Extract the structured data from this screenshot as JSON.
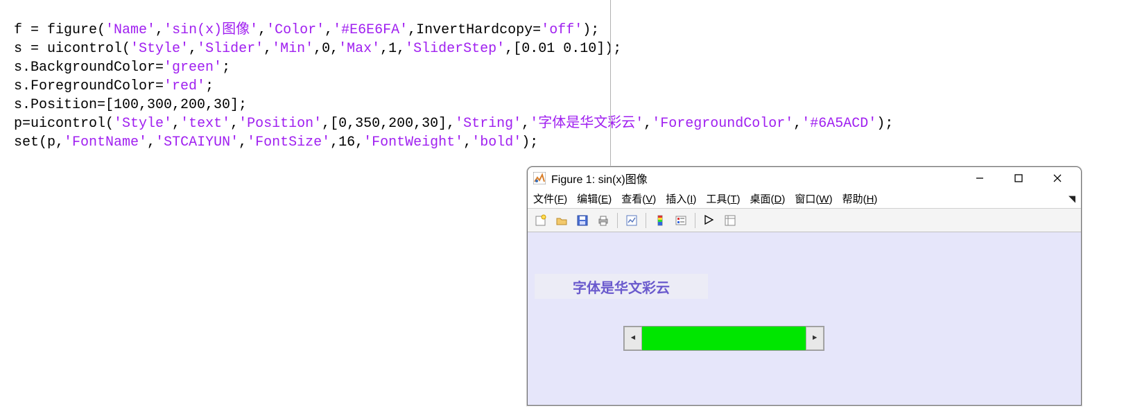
{
  "code": {
    "line1_pre": "f = figure(",
    "line1_s1": "'Name'",
    "line1_s2": "'sin(x)图像'",
    "line1_s3": "'Color'",
    "line1_s4": "'#E6E6FA'",
    "line1_tail": ",InvertHardcopy=",
    "line1_s5": "'off'",
    "line1_end": ");",
    "line2_pre": "s = uicontrol(",
    "line2_s1": "'Style'",
    "line2_s2": "'Slider'",
    "line2_s3": "'Min'",
    "line2_n1": ",0,",
    "line2_s4": "'Max'",
    "line2_n2": ",1,",
    "line2_s5": "'SliderStep'",
    "line2_n3": ",[0.01 0.10]);",
    "line3_pre": "s.BackgroundColor=",
    "line3_s1": "'green'",
    "line3_end": ";",
    "line4_pre": "s.ForegroundColor=",
    "line4_s1": "'red'",
    "line4_end": ";",
    "line5": "s.Position=[100,300,200,30];",
    "line6_pre": "p=uicontrol(",
    "line6_s1": "'Style'",
    "line6_s2": "'text'",
    "line6_s3": "'Position'",
    "line6_n1": ",[0,350,200,30],",
    "line6_s4": "'String'",
    "line6_s5": "'字体是华文彩云'",
    "line6_s6": "'ForegroundColor'",
    "line6_s7": "'#6A5ACD'",
    "line6_end": ");",
    "line7_pre": "set(p,",
    "line7_s1": "'FontName'",
    "line7_s2": "'STCAIYUN'",
    "line7_s3": "'FontSize'",
    "line7_n1": ",16,",
    "line7_s4": "'FontWeight'",
    "line7_s5": "'bold'",
    "line7_end": ");"
  },
  "figure": {
    "title": "Figure 1: sin(x)图像",
    "menu": {
      "file": "文件(F)",
      "edit": "编辑(E)",
      "view": "查看(V)",
      "insert": "插入(I)",
      "tools": "工具(T)",
      "desktop": "桌面(D)",
      "window": "窗口(W)",
      "help": "帮助(H)"
    },
    "text_ctrl": "字体是华文彩云",
    "slider_left": "◄",
    "slider_right": "►"
  }
}
